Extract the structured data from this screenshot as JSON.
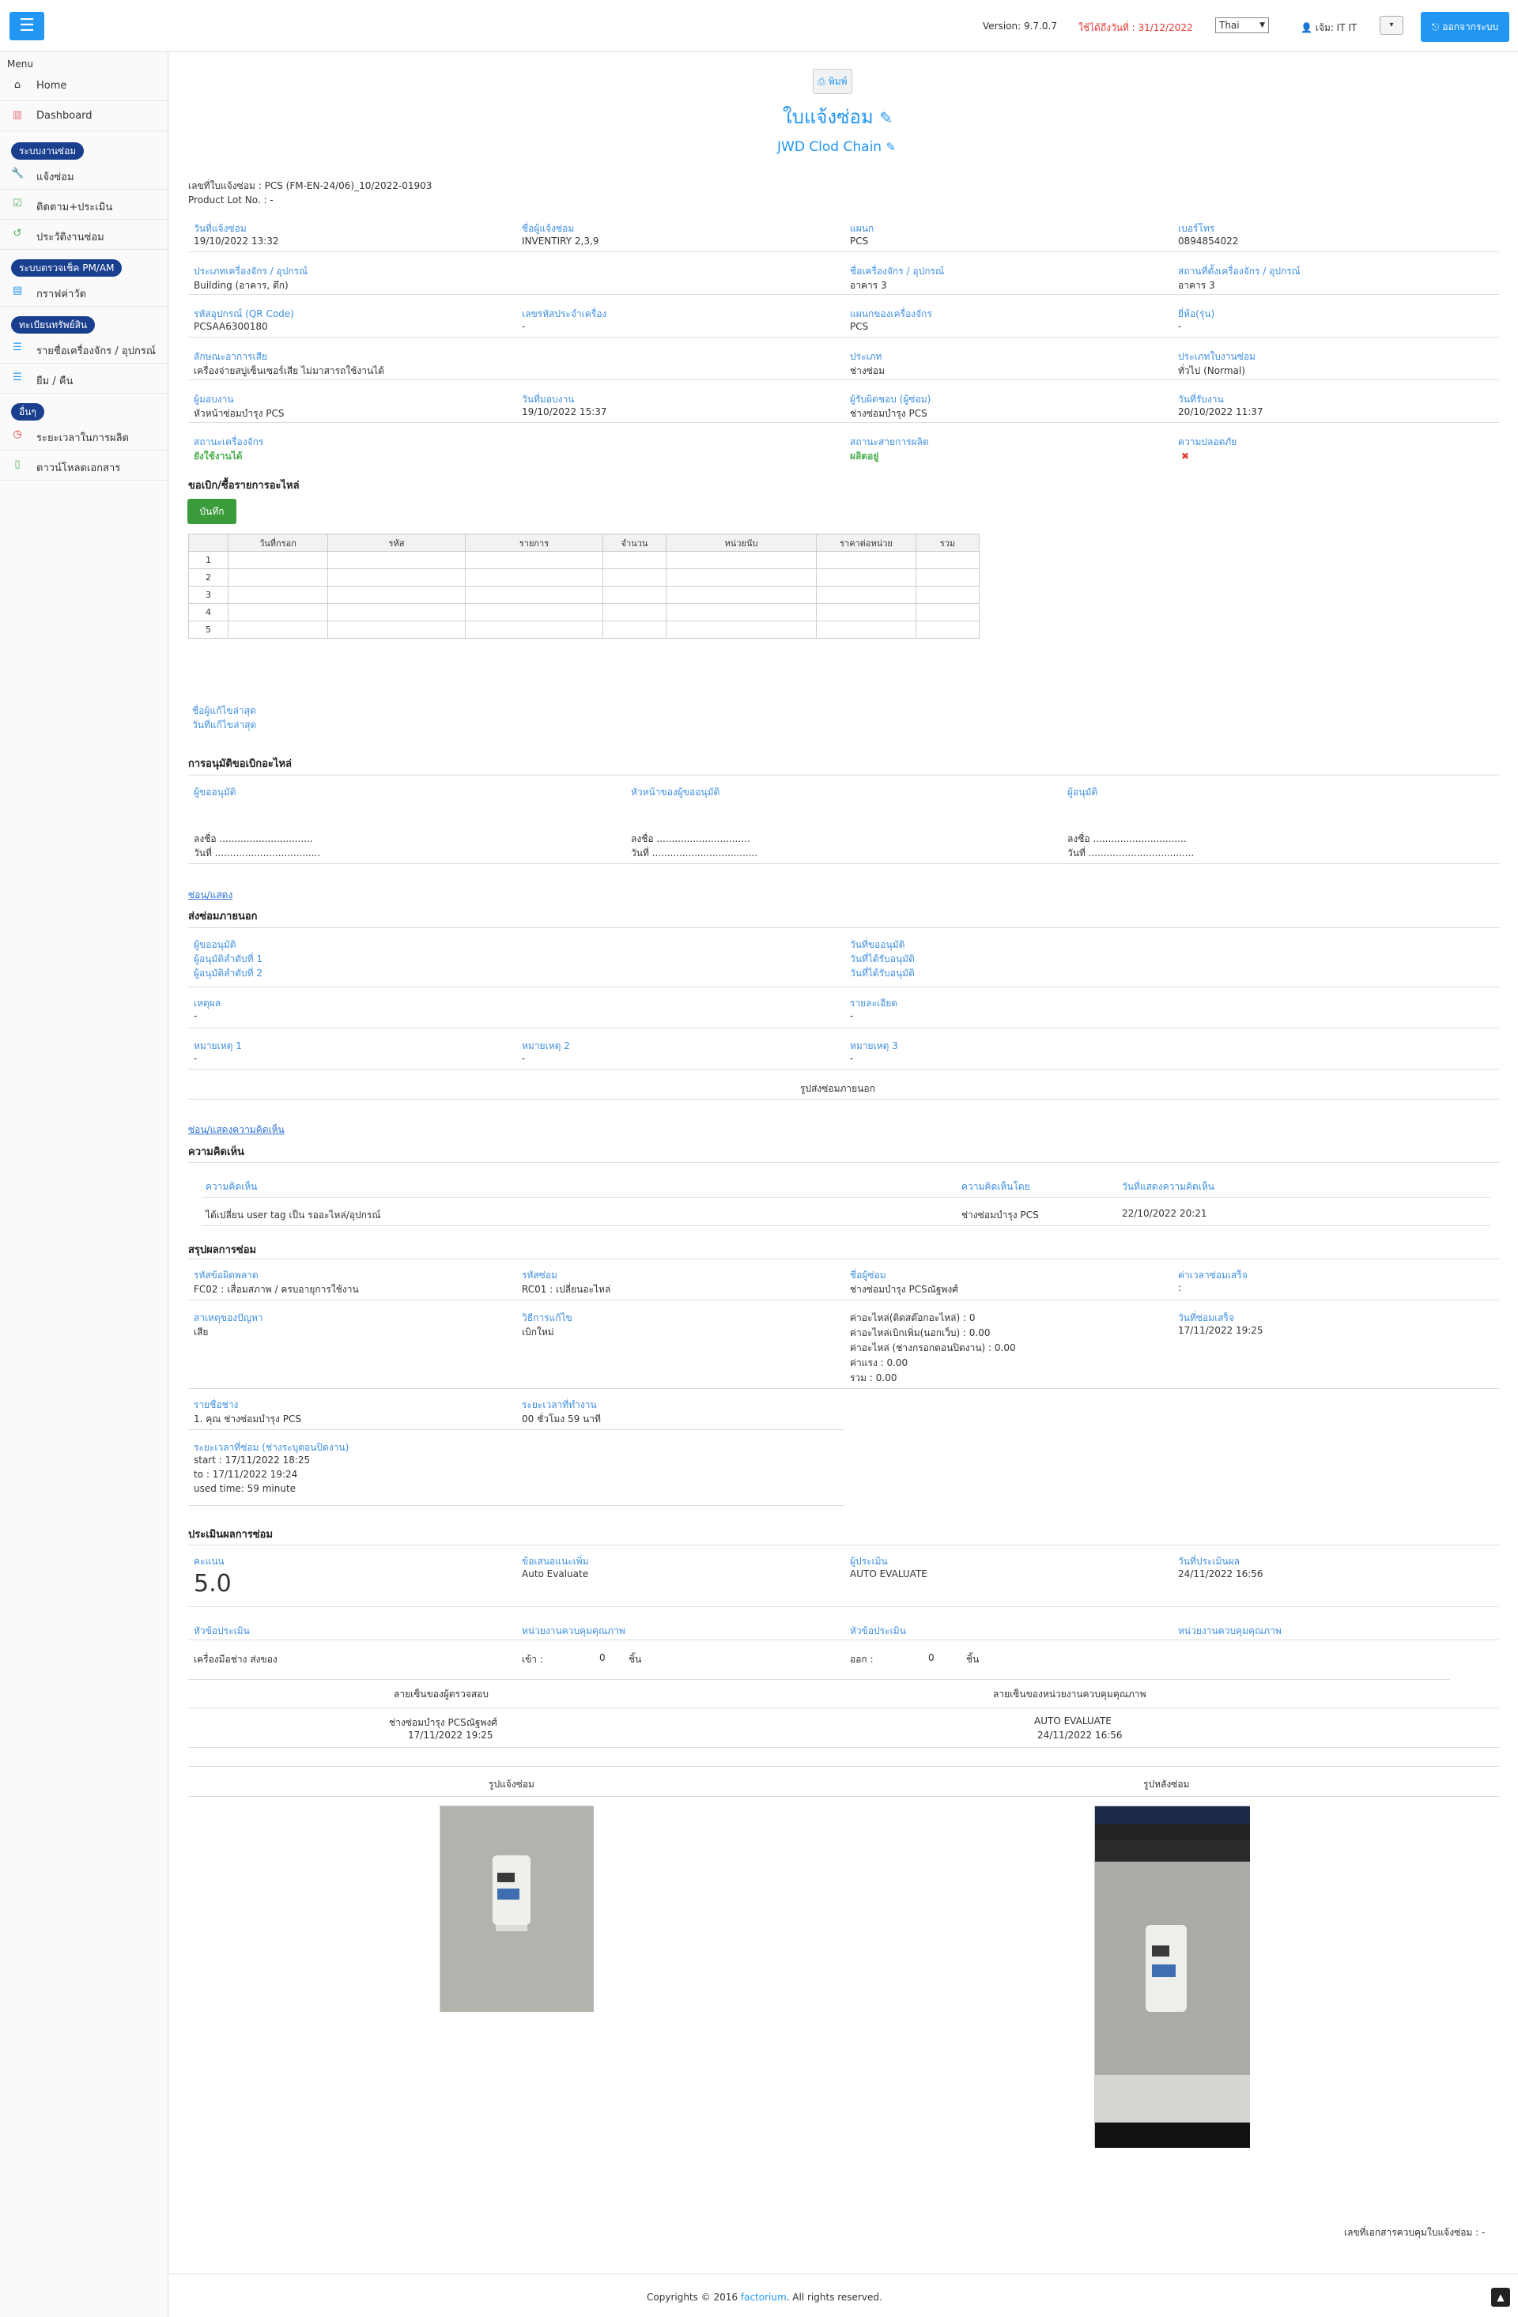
{
  "topbar": {
    "version": "Version: 9.7.0.7",
    "expire": "ใช้ได้ถึงวันที่ : 31/12/2022",
    "lang": "Thai",
    "user": "เจ้ม: IT IT",
    "logout": "ออกจากระบบ"
  },
  "sidebar": {
    "menu": "Menu",
    "home": "Home",
    "dashboard": "Dashboard",
    "group1": "ระบบงานซ่อม",
    "repair": "แจ้งซ่อม",
    "follow": "ติดตาม+ประเมิน",
    "history": "ประวัติงานซ่อม",
    "group2": "ระบบตรวจเช็ค PM/AM",
    "graph": "กราฟค่าวัด",
    "group3": "ทะเบียนทรัพย์สิน",
    "machines": "รายชื่อเครื่องจักร / อุปกรณ์",
    "borrow": "ยืม / คืน",
    "group4": "อื่นๆ",
    "downtime": "ระยะเวลาในการผลิต",
    "download": "ดาวน์โหลดเอกสาร"
  },
  "header": {
    "print": "พิมพ์",
    "title": "ใบแจ้งซ่อม",
    "company": "JWD Clod Chain"
  },
  "doc": {
    "no": "เลขที่ใบแจ้งซ่อม : PCS (FM-EN-24/06)_10/2022-01903",
    "lot": "Product Lot No. : -"
  },
  "fields": {
    "date_label": "วันที่แจ้งซ่อม",
    "date": "19/10/2022 13:32",
    "reporter_label": "ชื่อผู้แจ้งซ่อม",
    "reporter": "INVENTIRY 2,3,9",
    "dept_label": "แผนก",
    "dept": "PCS",
    "phone_label": "เบอร์โทร",
    "phone": "0894854022",
    "type_label": "ประเภทเครื่องจักร / อุปกรณ์",
    "type": "Building (อาคาร, ตึก)",
    "machine_label": "ชื่อเครื่องจักร / อุปกรณ์",
    "machine": "อาคาร 3",
    "location_label": "สถานที่ตั้งเครื่องจักร / อุปกรณ์",
    "location": "อาคาร 3",
    "asset_label": "รหัสอุปกรณ์ (QR Code)",
    "asset": "PCSAA6300180",
    "serial_label": "เลขรหัสประจำเครื่อง",
    "serial": "-",
    "mdept_label": "แผนกของเครื่องจักร",
    "mdept": "PCS",
    "brand_label": "ยี่ห้อ(รุ่น)",
    "brand": "-",
    "symptom_label": "ลักษณะอาการเสีย",
    "symptom": "เครื่องจ่ายสบู่เซ็นเซอร์เสีย ไม่มาสารถใช้งานได้",
    "cat_label": "ประเภท",
    "cat": "ช่างซ่อม",
    "jobtype_label": "ประเภทใบงานซ่อม",
    "jobtype": "ทั่วไป (Normal)",
    "assign_label": "ผู้มอบงาน",
    "assign": "หัวหน้าซ่อมบำรุง PCS",
    "assigndate_label": "วันที่มอบงาน",
    "assigndate": "19/10/2022 15:37",
    "receiver_label": "ผู้รับผิดชอบ (ผู้ซ่อม)",
    "receiver": "ช่างซ่อมบำรุง PCS",
    "recvdate_label": "วันที่รับงาน",
    "recvdate": "20/10/2022 11:37",
    "mstatus_label": "สถานะเครื่องจักร",
    "mstatus": "ยังใช้งานได้",
    "pstatus_label": "สถานะสายการผลิต",
    "pstatus": "ผลิตอยู่",
    "safety_label": "ความปลอดภัย",
    "safety": "✖"
  },
  "parts": {
    "title": "ขอเบิก/ซื้อรายการอะไหล่",
    "save": "บันทึก",
    "headers": [
      "",
      "วันที่กรอก",
      "รหัส",
      "รายการ",
      "จำนวน",
      "หน่วยนับ",
      "ราคาต่อหน่วย",
      "รวม"
    ],
    "rows": [
      "1",
      "2",
      "3",
      "4",
      "5"
    ],
    "editor_label": "ชื่อผู้แก้ไขล่าสุด",
    "editdate_label": "วันที่แก้ไขล่าสุด"
  },
  "approval": {
    "title": "การอนุมัติขอเบิกอะไหล่",
    "col1": "ผู้ขออนุมัติ",
    "col2": "หัวหน้าของผู้ขออนุมัติ",
    "col3": "ผู้อนุมัติ",
    "sign": "ลงชื่อ ...............................",
    "date": "วันที่ ..................................."
  },
  "outside": {
    "toggle": "ซ่อน/แสดง",
    "title": "ส่งซ่อมภายนอก",
    "req": "ผู้ขออนุมัติ",
    "a1": "ผู้อนุมัติลำดับที่ 1",
    "a2": "ผู้อนุมัติลำดับที่ 2",
    "reqdate": "วันที่ขออนุมัติ",
    "a1date": "วันที่ได้รับอนุมัติ",
    "a2date": "วันที่ได้รับอนุมัติ",
    "reason_label": "เหตุผล",
    "reason": "-",
    "detail_label": "รายละเอียด",
    "detail": "-",
    "n1_label": "หมายเหตุ 1",
    "n1": "-",
    "n2_label": "หมายเหตุ 2",
    "n2": "-",
    "n3_label": "หมายเหตุ 3",
    "n3": "-",
    "photo": "รูปส่งซ่อมภายนอก"
  },
  "comments": {
    "toggle": "ซ่อน/แสดงความคิดเห็น",
    "title": "ความคิดเห็น",
    "h1": "ความคิดเห็น",
    "h2": "ความคิดเห็นโดย",
    "h3": "วันที่แสดงความคิดเห็น",
    "c1": "ได้เปลี่ยน user tag เป็น รออะไหล่/อุปกรณ์",
    "by": "ช่างซ่อมบำรุง PCS",
    "at": "22/10/2022 20:21"
  },
  "summary": {
    "title": "สรุปผลการซ่อม",
    "cause_code_label": "รหัสข้อผิดพลาด",
    "cause_code": "FC02 : เสื่อมสภาพ / ครบอายุการใช้งาน",
    "fix_code_label": "รหัสซ่อม",
    "fix_code": "RC01 : เปลี่ยนอะไหล่",
    "tech_label": "ชื่อผู้ซ่อม",
    "tech": "ช่างซ่อมบำรุง PCSณัฐพงศ์",
    "duration_label": "ค่าเวลาซ่อมเสร็จ",
    "duration": ":",
    "cause_label": "สาเหตุของปัญหา",
    "cause": "เสีย",
    "method_label": "วิธีการแก้ไข",
    "method": "เบิกใหม่",
    "cost1": "ค่าอะไหล่(ติดสต๊อกอะไหล่) : 0",
    "cost2": "ค่าอะไหล่เบิกเพิ่ม(นอกเว็บ) : 0.00",
    "cost3": "ค่าอะไหล่ (ช่างกรอกตอนปิดงาน) : 0.00",
    "cost4": "ค่าแรง : 0.00",
    "cost5": "รวม : 0.00",
    "done_label": "วันที่ซ่อมเสร็จ",
    "done": "17/11/2022 19:25",
    "techlist_label": "รายชื่อช่าง",
    "techlist": "1. คุณ ช่างซ่อมบำรุง PCS",
    "work_label": "ระยะเวลาที่ทำงาน",
    "work": "00 ชั่วโมง 59 นาที",
    "period_label": "ระยะเวลาที่ซ่อม (ช่างระบุตอนปิดงาน)",
    "start": "start : 17/11/2022 18:25",
    "to": "to : 17/11/2022 19:24",
    "used": "used time: 59 minute"
  },
  "evaluation": {
    "title": "ประเมินผลการซ่อม",
    "score_label": "คะแนน",
    "score": "5.0",
    "sugg_label": "ข้อเสนอแนะเพิ่ม",
    "sugg": "Auto Evaluate",
    "evaluator_label": "ผู้ประเมิน",
    "evaluator": "AUTO EVALUATE",
    "evaldate_label": "วันที่ประเมินผล",
    "evaldate": "24/11/2022 16:56",
    "t1": "หัวข้อประเมิน",
    "t2": "หน่วยงานควบคุมคุณภาพ",
    "t3": "หัวข้อประเมิน",
    "t4": "หน่วยงานควบคุมคุณภาพ",
    "tool": "เครื่องมือช่าง ส่งของ",
    "in_label": "เข้า :",
    "in_val": "0",
    "in_unit": "ชิ้น",
    "out_label": "ออก :",
    "out_val": "0",
    "out_unit": "ชิ้น",
    "sig1_label": "ลายเซ็นของผู้ตรวจสอบ",
    "sig2_label": "ลายเซ็นของหน่วยงานควบคุมคุณภาพ",
    "sig1_name": "ช่างซ่อมบำรุง PCSณัฐพงศ์",
    "sig1_date": "17/11/2022 19:25",
    "sig2_name": "AUTO EVALUATE",
    "sig2_date": "24/11/2022 16:56"
  },
  "photos": {
    "before": "รูปแจ้งซ่อม",
    "after": "รูปหลังซ่อม"
  },
  "footer": {
    "docno": "เลขที่เอกสารควบคุมใบแจ้งซ่อม : -",
    "copy_pre": "Copyrights © 2016 ",
    "brand": "factorium",
    "copy_post": ". All rights reserved."
  }
}
